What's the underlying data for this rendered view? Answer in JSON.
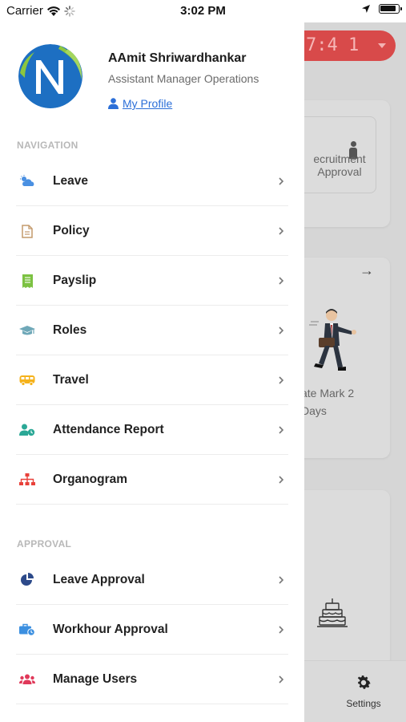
{
  "status_bar": {
    "carrier": "Carrier",
    "time": "3:02 PM"
  },
  "profile": {
    "name": "AAmit Shriwardhankar",
    "role": "Assistant Manager Operations",
    "link_label": "My Profile"
  },
  "navigation": {
    "title": "NAVIGATION",
    "items": [
      {
        "label": "Leave",
        "icon": "cloud-sun-icon",
        "color": "#4a90e2"
      },
      {
        "label": "Policy",
        "icon": "document-icon",
        "color": "#c49a6c"
      },
      {
        "label": "Payslip",
        "icon": "receipt-icon",
        "color": "#7cc242"
      },
      {
        "label": "Roles",
        "icon": "graduation-cap-icon",
        "color": "#6fa8b8"
      },
      {
        "label": "Travel",
        "icon": "bus-icon",
        "color": "#f5b21b"
      },
      {
        "label": "Attendance Report",
        "icon": "user-clock-icon",
        "color": "#2ba896"
      },
      {
        "label": "Organogram",
        "icon": "sitemap-icon",
        "color": "#e8413a"
      }
    ]
  },
  "approval": {
    "title": "APPROVAL",
    "items": [
      {
        "label": "Leave Approval",
        "icon": "pie-chart-icon",
        "color": "#2d4a8a"
      },
      {
        "label": "Workhour Approval",
        "icon": "briefcase-clock-icon",
        "color": "#3b8fe0"
      },
      {
        "label": "Manage Users",
        "icon": "users-icon",
        "color": "#e0395a"
      }
    ]
  },
  "background": {
    "clock_text": "7:4 1",
    "card1_label": "ecruitment Approval",
    "card2_label": "ate Mark 2 Days",
    "tab_settings": "Settings"
  }
}
